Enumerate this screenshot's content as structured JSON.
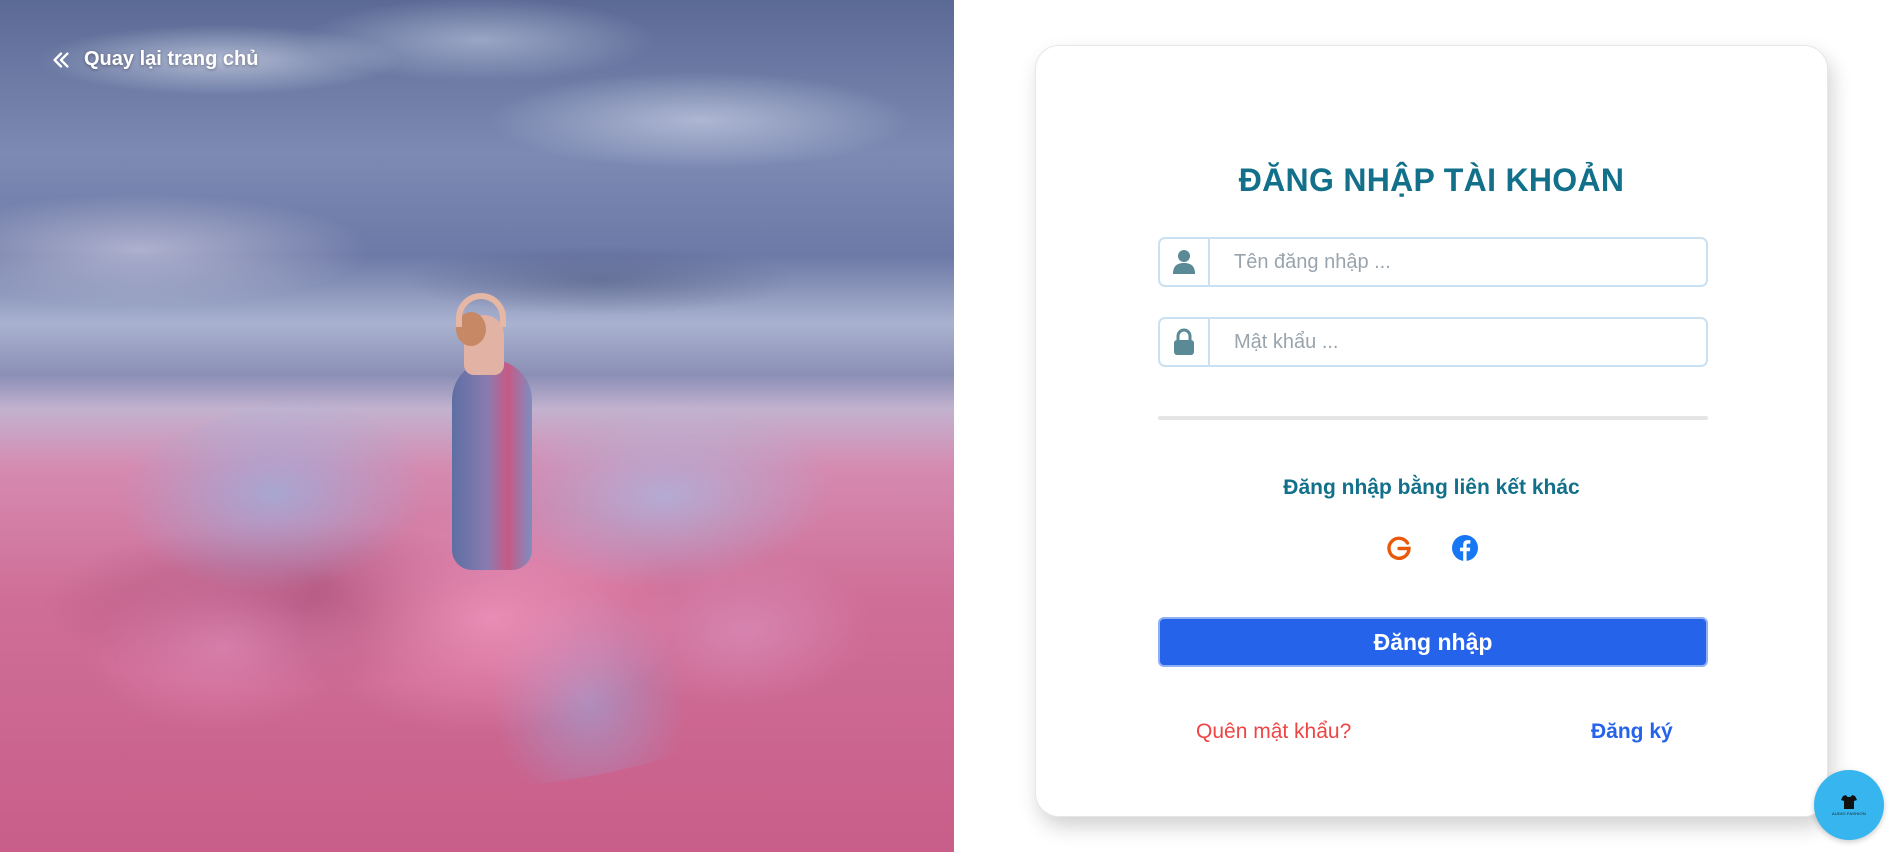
{
  "hero": {
    "back_link_label": "Quay lại trang chủ",
    "back_icon": "double-chevron-left-icon"
  },
  "login": {
    "title": "ĐĂNG NHẬP TÀI KHOẢN",
    "username": {
      "placeholder": "Tên đăng nhập ...",
      "value": "",
      "icon": "user-icon"
    },
    "password": {
      "placeholder": "Mật khẩu ...",
      "value": "",
      "icon": "lock-icon"
    },
    "alt_login_label": "Đăng nhập bằng liên kết khác",
    "social": [
      {
        "name": "google",
        "icon": "google-icon",
        "color": "#ea580c"
      },
      {
        "name": "facebook",
        "icon": "facebook-icon",
        "color": "#1877f2"
      }
    ],
    "submit_label": "Đăng nhập",
    "forgot_label": "Quên mật khẩu?",
    "register_label": "Đăng ký"
  },
  "chat_widget": {
    "logo_text": "AUDIO FASHION"
  },
  "colors": {
    "title": "#12708b",
    "primary": "#2563eb",
    "danger": "#ef4444",
    "field_border": "#c9e1f3",
    "icon": "#5b8a97",
    "chat_bg": "#37b5ee"
  }
}
